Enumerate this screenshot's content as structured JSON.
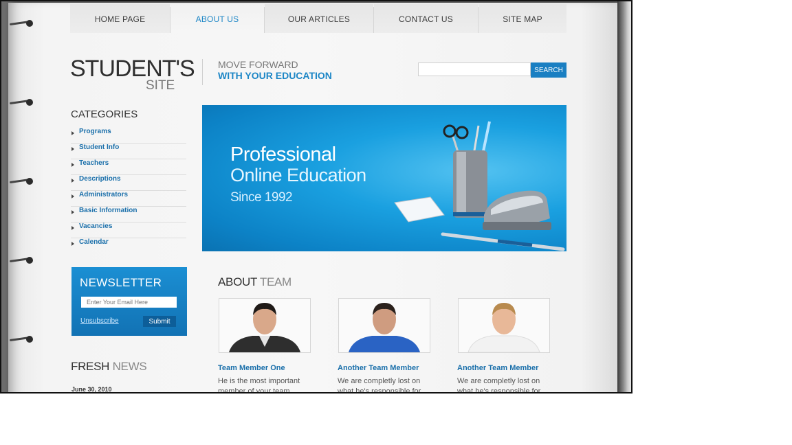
{
  "nav": {
    "items": [
      {
        "label": "HOME PAGE"
      },
      {
        "label": "ABOUT US",
        "active": true
      },
      {
        "label": "OUR ARTICLES"
      },
      {
        "label": "CONTACT US"
      },
      {
        "label": "SITE MAP"
      }
    ]
  },
  "logo": {
    "main": "STUDENT'S",
    "sub": "SITE"
  },
  "tagline": {
    "line1": "MOVE FORWARD",
    "line2": "WITH YOUR EDUCATION"
  },
  "search": {
    "placeholder": "",
    "button": "SEARCH"
  },
  "categories": {
    "title": "CATEGORIES",
    "items": [
      "Programs",
      "Student Info",
      "Teachers",
      "Descriptions",
      "Administrators",
      "Basic Information",
      "Vacancies",
      "Calendar"
    ]
  },
  "hero": {
    "line1": "Professional",
    "line2": "Online Education",
    "line3": "Since 1992"
  },
  "newsletter": {
    "title": "NEWSLETTER",
    "email_placeholder": "Enter Your Email Here",
    "unsubscribe": "Unsubscribe",
    "submit": "Submit"
  },
  "fresh_news": {
    "title_bold": "FRESH",
    "title_light": "NEWS",
    "date": "June 30, 2010"
  },
  "about_team": {
    "title_bold": "ABOUT",
    "title_light": "TEAM",
    "members": [
      {
        "name": "Team Member One",
        "desc": "He is the most important member of your team"
      },
      {
        "name": "Another Team Member",
        "desc": "We are completly lost on what he's responsible for"
      },
      {
        "name": "Another Team Member",
        "desc": "We are completly lost on what he's responsible for"
      }
    ]
  },
  "colors": {
    "accent": "#1c86c6",
    "hero_blue": "#1aa0e0",
    "newsletter_blue": "#1b8fd3"
  },
  "icons": [
    "binder-ring-icon",
    "bullet-arrow-icon"
  ]
}
